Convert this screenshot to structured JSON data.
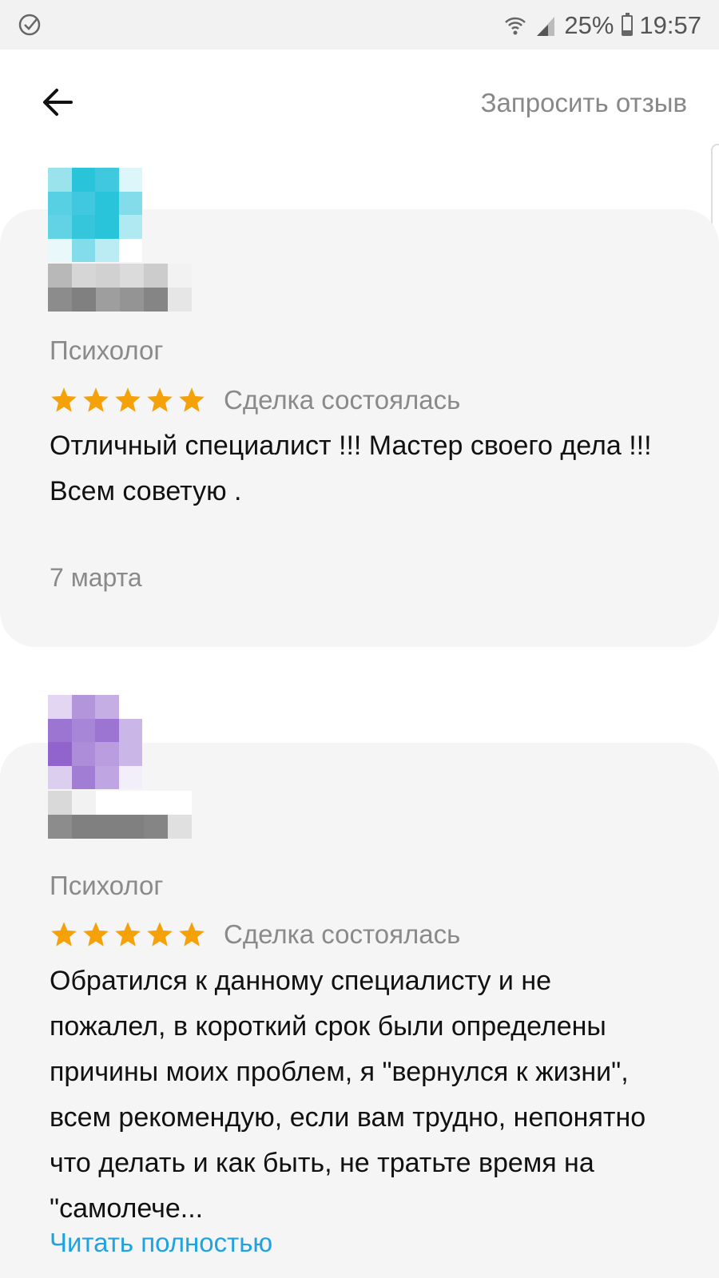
{
  "status_bar": {
    "battery": "25%",
    "battery_level": 0.25,
    "time": "19:57"
  },
  "header": {
    "request_review_label": "Запросить отзыв"
  },
  "reviews": [
    {
      "role": "Психолог",
      "rating": 5,
      "deal_status": "Сделка состоялась",
      "text": "Отличный специалист !!! Мастер своего дела !!!\nВсем советую .",
      "date": "7 марта",
      "avatar_color": "#1ec0d8"
    },
    {
      "role": "Психолог",
      "rating": 5,
      "deal_status": "Сделка состоялась",
      "text": "Обратился к данному специалисту и не пожалел, в короткий срок были определены причины моих проблем, я \"вернулся к жизни\", всем рекомендую, если вам трудно, непонятно что делать и как быть, не тратьте время на \"самолече...",
      "read_more": "Читать полностью",
      "avatar_color": "#8a5cc9"
    }
  ],
  "colors": {
    "star": "#f5a10a",
    "link": "#1ea3e0",
    "card_bg": "#f5f5f5"
  }
}
